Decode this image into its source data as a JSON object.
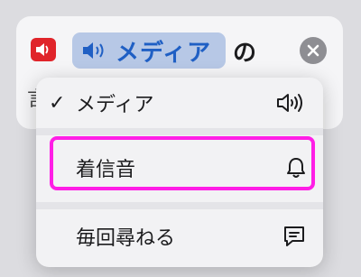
{
  "header": {
    "app_icon": "speaker-icon",
    "chip_icon": "speaker-icon",
    "chip_label": "メディア",
    "suffix": "の",
    "partial_text": "言",
    "close_icon": "close-icon"
  },
  "menu": {
    "items": [
      {
        "label": "メディア",
        "checked": true,
        "icon": "speaker-wave-icon"
      },
      {
        "label": "着信音",
        "checked": false,
        "icon": "bell-icon"
      },
      {
        "label": "毎回尋ねる",
        "checked": false,
        "icon": "message-icon"
      }
    ],
    "check_glyph": "✓"
  },
  "colors": {
    "accent_blue": "#1f5fc4",
    "chip_bg": "#b7c8e6",
    "app_red": "#e0242a",
    "highlight": "#ff1ee6"
  }
}
